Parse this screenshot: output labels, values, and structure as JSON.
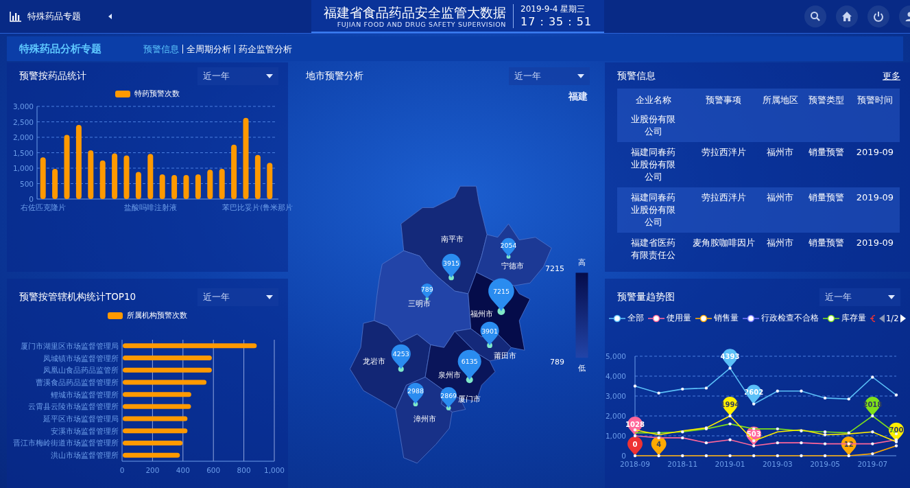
{
  "header": {
    "app_title": "特殊药品专题",
    "main_title": "福建省食品药品安全监管大数据",
    "subtitle": "FUJIAN FOOD AND DRUG SAFETY SUPERVISION",
    "date": "2019-9-4 星期三",
    "time": "17 : 35 : 51"
  },
  "subheader": {
    "title": "特殊药品分析专题",
    "tabs": [
      {
        "label": "预警信息",
        "selected": true
      },
      {
        "label": "全周期分析",
        "selected": false
      },
      {
        "label": "药企监管分析",
        "selected": false
      }
    ]
  },
  "drug_panel": {
    "title": "预警按药品统计",
    "filter": "近一年",
    "chart_data": {
      "type": "bar",
      "grid": true,
      "ylim": [
        0,
        3000
      ],
      "yticks": [
        {
          "value": 0,
          "label": "0"
        },
        {
          "value": 500,
          "label": "500"
        },
        {
          "value": 1000,
          "label": "1,000"
        },
        {
          "value": 1500,
          "label": "1,500"
        },
        {
          "value": 2000,
          "label": "2,000"
        },
        {
          "value": 2500,
          "label": "2,500"
        },
        {
          "value": 3000,
          "label": "3,000"
        }
      ],
      "categories": [
        "右佐匹克隆片",
        null,
        null,
        null,
        null,
        null,
        null,
        null,
        null,
        "盐酸吗啡注射液",
        null,
        null,
        null,
        null,
        null,
        null,
        null,
        null,
        "苯巴比妥片(鲁米那片",
        null
      ],
      "series": [
        {
          "name": "特药预警次数",
          "color": "#ff9900",
          "values": [
            1350,
            980,
            2080,
            2400,
            1580,
            1250,
            1480,
            1410,
            880,
            1460,
            800,
            780,
            780,
            800,
            950,
            980,
            1760,
            2630,
            1430,
            1170
          ]
        }
      ]
    }
  },
  "agency_panel": {
    "title": "预警按管辖机构统计TOP10",
    "filter": "近一年",
    "chart_data": {
      "type": "bar",
      "orientation": "horizontal",
      "grid": true,
      "xlim": [
        0,
        1000
      ],
      "categories": [
        "厦门市湖里区市场监督管理局",
        "凤城镇市场监督管理所",
        "凤凰山食品药品监管所",
        "曹溪食品药品监督管理所",
        "鲤城市场监督管理所",
        "云霄县云陵市场监督管理所",
        "延平区市场监督管理局",
        "安溪市场监督管理所",
        "晋江市梅岭街道市场监督管理所",
        "洪山市场监督管理所"
      ],
      "xticks": [
        {
          "value": 0,
          "label": "0"
        },
        {
          "value": 200,
          "label": "200"
        },
        {
          "value": 400,
          "label": "400"
        },
        {
          "value": 600,
          "label": "600"
        },
        {
          "value": 800,
          "label": "800"
        },
        {
          "value": 1000,
          "label": "1,000"
        }
      ],
      "series": [
        {
          "name": "所属机构预警次数",
          "color": "#ff9900",
          "values": [
            880,
            585,
            585,
            550,
            450,
            448,
            425,
            425,
            393,
            375
          ]
        }
      ]
    }
  },
  "map_panel": {
    "title": "地市预警分析",
    "filter": "近一年",
    "region": "福建",
    "cities": [
      {
        "name": "南平市",
        "value": "3915"
      },
      {
        "name": "宁德市",
        "value": "2054"
      },
      {
        "name": "三明市",
        "value": "789"
      },
      {
        "name": "福州市",
        "value": "7215"
      },
      {
        "name": "莆田市",
        "value": "3901"
      },
      {
        "name": "龙岩市",
        "value": "4253"
      },
      {
        "name": "泉州市",
        "value": "6135"
      },
      {
        "name": "厦门市",
        "value": "2869"
      },
      {
        "name": "漳州市",
        "value": "2988"
      }
    ],
    "legend": {
      "max": "7215",
      "min": "789",
      "high": "高",
      "low": "低"
    }
  },
  "alert_panel": {
    "title": "预警信息",
    "more": "更多",
    "table": {
      "columns": [
        "企业名称",
        "预警事项",
        "所属地区",
        "预警类型",
        "预警时间"
      ],
      "rows": [
        {
          "company": "业股份有限公司"
        },
        {
          "company": "福建同春药业股份有限公司",
          "item": "劳拉西泮片",
          "area": "福州市",
          "type": "销量预警",
          "time": "2019-09"
        },
        {
          "company": "福建同春药业股份有限公司",
          "item": "劳拉西泮片",
          "area": "福州市",
          "type": "销量预警",
          "time": "2019-09"
        },
        {
          "company": "福建省医药有限责任公",
          "item": "麦角胺咖啡因片",
          "area": "福州市",
          "type": "销量预警",
          "time": "2019-09"
        }
      ]
    }
  },
  "trend_panel": {
    "title": "预警量趋势图",
    "filter": "近一年",
    "cut_legend_item": {
      "color": "#ee3333"
    },
    "pager": {
      "text": "1/2",
      "prev_disabled": true,
      "next_disabled": false
    },
    "chart_data": {
      "type": "line",
      "grid": true,
      "ylim": [
        0,
        5000
      ],
      "yticks": [
        {
          "value": 0,
          "label": "0"
        },
        {
          "value": 1000,
          "label": "1,000"
        },
        {
          "value": 2000,
          "label": "2,000"
        },
        {
          "value": 3000,
          "label": "3,000"
        },
        {
          "value": 4000,
          "label": "4,000"
        },
        {
          "value": 5000,
          "label": "5,000"
        }
      ],
      "categories": [
        "2018-09",
        null,
        "2018-11",
        null,
        "2019-01",
        null,
        "2019-03",
        null,
        "2019-05",
        null,
        "2019-07",
        null
      ],
      "series": [
        {
          "name": "全部",
          "color": "#5bc0f8",
          "values": [
            3500,
            3150,
            3350,
            3400,
            4400,
            2600,
            3250,
            3250,
            2900,
            2850,
            3950,
            3050
          ]
        },
        {
          "name": "使用量",
          "color": "#ff6699",
          "values": [
            1000,
            900,
            900,
            650,
            800,
            500,
            650,
            650,
            600,
            600,
            600,
            800
          ]
        },
        {
          "name": "销售量",
          "color": "#ffaa00",
          "values": [
            0,
            0,
            0,
            0,
            0,
            0,
            0,
            0,
            0,
            0,
            100,
            500
          ]
        },
        {
          "name": "行政检查不合格",
          "color": "#7777ff",
          "values": [
            null,
            null,
            null,
            null,
            null,
            null,
            null,
            null,
            null,
            null,
            null,
            null
          ]
        },
        {
          "name": "库存量",
          "color": "#7fe01a",
          "values": [
            1150,
            1150,
            1200,
            1350,
            1600,
            1350,
            1350,
            1250,
            1200,
            1150,
            2000,
            1100
          ]
        },
        {
          "color": "#ffee00",
          "values": [
            1300,
            1050,
            1250,
            1400,
            2000,
            750,
            1200,
            1300,
            1050,
            1100,
            1200,
            700
          ]
        }
      ]
    },
    "pins": [
      {
        "label": "1028",
        "color": "#ff6699"
      },
      {
        "label": "0",
        "color": "#ee3333"
      },
      {
        "label": "4",
        "color": "#ffaa00"
      },
      {
        "label": "4393",
        "color": "#5bc0f8"
      },
      {
        "label": "1994",
        "color": "#ffee00"
      },
      {
        "label": "2602",
        "color": "#5bc0f8"
      },
      {
        "label": "503",
        "color": "#ff6699"
      },
      {
        "label": "12",
        "color": "#ffaa00"
      },
      {
        "label": "2018",
        "color": "#7fe01a"
      },
      {
        "label": "700",
        "color": "#ffee00"
      }
    ]
  }
}
